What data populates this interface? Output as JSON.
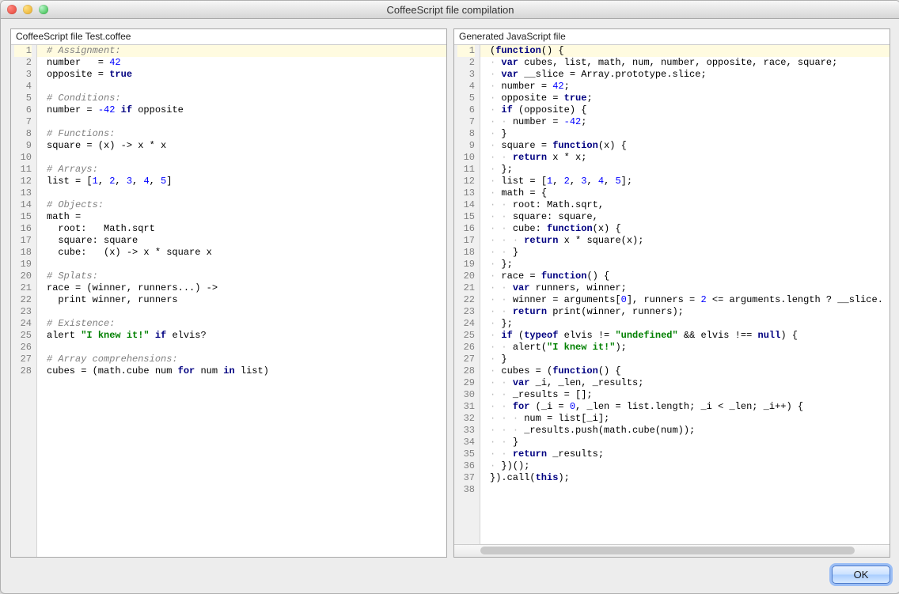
{
  "window": {
    "title": "CoffeeScript file compilation"
  },
  "footer": {
    "ok_label": "OK"
  },
  "left": {
    "header": "CoffeeScript file Test.coffee",
    "lines": [
      {
        "n": 1,
        "segs": [
          {
            "cls": "tk-comment",
            "t": "# Assignment:"
          }
        ]
      },
      {
        "n": 2,
        "segs": [
          {
            "cls": "tk-plain",
            "t": "number   = "
          },
          {
            "cls": "tk-num",
            "t": "42"
          }
        ]
      },
      {
        "n": 3,
        "segs": [
          {
            "cls": "tk-plain",
            "t": "opposite = "
          },
          {
            "cls": "tk-kw",
            "t": "true"
          }
        ]
      },
      {
        "n": 4,
        "segs": [
          {
            "cls": "tk-plain",
            "t": ""
          }
        ]
      },
      {
        "n": 5,
        "segs": [
          {
            "cls": "tk-comment",
            "t": "# Conditions:"
          }
        ]
      },
      {
        "n": 6,
        "segs": [
          {
            "cls": "tk-plain",
            "t": "number = "
          },
          {
            "cls": "tk-num",
            "t": "-42"
          },
          {
            "cls": "tk-plain",
            "t": " "
          },
          {
            "cls": "tk-kw",
            "t": "if"
          },
          {
            "cls": "tk-plain",
            "t": " opposite"
          }
        ]
      },
      {
        "n": 7,
        "segs": [
          {
            "cls": "tk-plain",
            "t": ""
          }
        ]
      },
      {
        "n": 8,
        "segs": [
          {
            "cls": "tk-comment",
            "t": "# Functions:"
          }
        ]
      },
      {
        "n": 9,
        "segs": [
          {
            "cls": "tk-plain",
            "t": "square = (x) -> x * x"
          }
        ]
      },
      {
        "n": 10,
        "segs": [
          {
            "cls": "tk-plain",
            "t": ""
          }
        ]
      },
      {
        "n": 11,
        "segs": [
          {
            "cls": "tk-comment",
            "t": "# Arrays:"
          }
        ]
      },
      {
        "n": 12,
        "segs": [
          {
            "cls": "tk-plain",
            "t": "list = ["
          },
          {
            "cls": "tk-num",
            "t": "1"
          },
          {
            "cls": "tk-plain",
            "t": ", "
          },
          {
            "cls": "tk-num",
            "t": "2"
          },
          {
            "cls": "tk-plain",
            "t": ", "
          },
          {
            "cls": "tk-num",
            "t": "3"
          },
          {
            "cls": "tk-plain",
            "t": ", "
          },
          {
            "cls": "tk-num",
            "t": "4"
          },
          {
            "cls": "tk-plain",
            "t": ", "
          },
          {
            "cls": "tk-num",
            "t": "5"
          },
          {
            "cls": "tk-plain",
            "t": "]"
          }
        ]
      },
      {
        "n": 13,
        "segs": [
          {
            "cls": "tk-plain",
            "t": ""
          }
        ]
      },
      {
        "n": 14,
        "segs": [
          {
            "cls": "tk-comment",
            "t": "# Objects:"
          }
        ]
      },
      {
        "n": 15,
        "segs": [
          {
            "cls": "tk-plain",
            "t": "math ="
          }
        ]
      },
      {
        "n": 16,
        "segs": [
          {
            "cls": "tk-plain",
            "t": "  root:   Math.sqrt"
          }
        ]
      },
      {
        "n": 17,
        "segs": [
          {
            "cls": "tk-plain",
            "t": "  square: square"
          }
        ]
      },
      {
        "n": 18,
        "segs": [
          {
            "cls": "tk-plain",
            "t": "  cube:   (x) -> x * square x"
          }
        ]
      },
      {
        "n": 19,
        "segs": [
          {
            "cls": "tk-plain",
            "t": ""
          }
        ]
      },
      {
        "n": 20,
        "segs": [
          {
            "cls": "tk-comment",
            "t": "# Splats:"
          }
        ]
      },
      {
        "n": 21,
        "segs": [
          {
            "cls": "tk-plain",
            "t": "race = (winner, runners...) ->"
          }
        ]
      },
      {
        "n": 22,
        "segs": [
          {
            "cls": "tk-plain",
            "t": "  print winner, runners"
          }
        ]
      },
      {
        "n": 23,
        "segs": [
          {
            "cls": "tk-plain",
            "t": ""
          }
        ]
      },
      {
        "n": 24,
        "segs": [
          {
            "cls": "tk-comment",
            "t": "# Existence:"
          }
        ]
      },
      {
        "n": 25,
        "segs": [
          {
            "cls": "tk-plain",
            "t": "alert "
          },
          {
            "cls": "tk-str",
            "t": "\"I knew it!\""
          },
          {
            "cls": "tk-plain",
            "t": " "
          },
          {
            "cls": "tk-kw",
            "t": "if"
          },
          {
            "cls": "tk-plain",
            "t": " elvis?"
          }
        ]
      },
      {
        "n": 26,
        "segs": [
          {
            "cls": "tk-plain",
            "t": ""
          }
        ]
      },
      {
        "n": 27,
        "segs": [
          {
            "cls": "tk-comment",
            "t": "# Array comprehensions:"
          }
        ]
      },
      {
        "n": 28,
        "segs": [
          {
            "cls": "tk-plain",
            "t": "cubes = (math.cube num "
          },
          {
            "cls": "tk-kw",
            "t": "for"
          },
          {
            "cls": "tk-plain",
            "t": " num "
          },
          {
            "cls": "tk-kw",
            "t": "in"
          },
          {
            "cls": "tk-plain",
            "t": " list)"
          }
        ]
      }
    ]
  },
  "right": {
    "header": "Generated JavaScript file",
    "lines": [
      {
        "n": 1,
        "ind": 0,
        "segs": [
          {
            "cls": "tk-plain",
            "t": "("
          },
          {
            "cls": "tk-kw",
            "t": "function"
          },
          {
            "cls": "tk-plain",
            "t": "() {"
          }
        ]
      },
      {
        "n": 2,
        "ind": 1,
        "segs": [
          {
            "cls": "tk-kw",
            "t": "var"
          },
          {
            "cls": "tk-plain",
            "t": " cubes, list, math, num, number, opposite, race, square;"
          }
        ]
      },
      {
        "n": 3,
        "ind": 1,
        "segs": [
          {
            "cls": "tk-kw",
            "t": "var"
          },
          {
            "cls": "tk-plain",
            "t": " __slice = Array.prototype.slice;"
          }
        ]
      },
      {
        "n": 4,
        "ind": 1,
        "segs": [
          {
            "cls": "tk-plain",
            "t": "number = "
          },
          {
            "cls": "tk-num",
            "t": "42"
          },
          {
            "cls": "tk-plain",
            "t": ";"
          }
        ]
      },
      {
        "n": 5,
        "ind": 1,
        "segs": [
          {
            "cls": "tk-plain",
            "t": "opposite = "
          },
          {
            "cls": "tk-kw",
            "t": "true"
          },
          {
            "cls": "tk-plain",
            "t": ";"
          }
        ]
      },
      {
        "n": 6,
        "ind": 1,
        "segs": [
          {
            "cls": "tk-kw",
            "t": "if"
          },
          {
            "cls": "tk-plain",
            "t": " (opposite) {"
          }
        ]
      },
      {
        "n": 7,
        "ind": 2,
        "segs": [
          {
            "cls": "tk-plain",
            "t": "number = "
          },
          {
            "cls": "tk-num",
            "t": "-42"
          },
          {
            "cls": "tk-plain",
            "t": ";"
          }
        ]
      },
      {
        "n": 8,
        "ind": 1,
        "segs": [
          {
            "cls": "tk-plain",
            "t": "}"
          }
        ]
      },
      {
        "n": 9,
        "ind": 1,
        "segs": [
          {
            "cls": "tk-plain",
            "t": "square = "
          },
          {
            "cls": "tk-kw",
            "t": "function"
          },
          {
            "cls": "tk-plain",
            "t": "(x) {"
          }
        ]
      },
      {
        "n": 10,
        "ind": 2,
        "segs": [
          {
            "cls": "tk-kw",
            "t": "return"
          },
          {
            "cls": "tk-plain",
            "t": " x * x;"
          }
        ]
      },
      {
        "n": 11,
        "ind": 1,
        "segs": [
          {
            "cls": "tk-plain",
            "t": "};"
          }
        ]
      },
      {
        "n": 12,
        "ind": 1,
        "segs": [
          {
            "cls": "tk-plain",
            "t": "list = ["
          },
          {
            "cls": "tk-num",
            "t": "1"
          },
          {
            "cls": "tk-plain",
            "t": ", "
          },
          {
            "cls": "tk-num",
            "t": "2"
          },
          {
            "cls": "tk-plain",
            "t": ", "
          },
          {
            "cls": "tk-num",
            "t": "3"
          },
          {
            "cls": "tk-plain",
            "t": ", "
          },
          {
            "cls": "tk-num",
            "t": "4"
          },
          {
            "cls": "tk-plain",
            "t": ", "
          },
          {
            "cls": "tk-num",
            "t": "5"
          },
          {
            "cls": "tk-plain",
            "t": "];"
          }
        ]
      },
      {
        "n": 13,
        "ind": 1,
        "segs": [
          {
            "cls": "tk-plain",
            "t": "math = {"
          }
        ]
      },
      {
        "n": 14,
        "ind": 2,
        "segs": [
          {
            "cls": "tk-plain",
            "t": "root: Math.sqrt,"
          }
        ]
      },
      {
        "n": 15,
        "ind": 2,
        "segs": [
          {
            "cls": "tk-plain",
            "t": "square: square,"
          }
        ]
      },
      {
        "n": 16,
        "ind": 2,
        "segs": [
          {
            "cls": "tk-plain",
            "t": "cube: "
          },
          {
            "cls": "tk-kw",
            "t": "function"
          },
          {
            "cls": "tk-plain",
            "t": "(x) {"
          }
        ]
      },
      {
        "n": 17,
        "ind": 3,
        "segs": [
          {
            "cls": "tk-kw",
            "t": "return"
          },
          {
            "cls": "tk-plain",
            "t": " x * square(x);"
          }
        ]
      },
      {
        "n": 18,
        "ind": 2,
        "segs": [
          {
            "cls": "tk-plain",
            "t": "}"
          }
        ]
      },
      {
        "n": 19,
        "ind": 1,
        "segs": [
          {
            "cls": "tk-plain",
            "t": "};"
          }
        ]
      },
      {
        "n": 20,
        "ind": 1,
        "segs": [
          {
            "cls": "tk-plain",
            "t": "race = "
          },
          {
            "cls": "tk-kw",
            "t": "function"
          },
          {
            "cls": "tk-plain",
            "t": "() {"
          }
        ]
      },
      {
        "n": 21,
        "ind": 2,
        "segs": [
          {
            "cls": "tk-kw",
            "t": "var"
          },
          {
            "cls": "tk-plain",
            "t": " runners, winner;"
          }
        ]
      },
      {
        "n": 22,
        "ind": 2,
        "segs": [
          {
            "cls": "tk-plain",
            "t": "winner = arguments["
          },
          {
            "cls": "tk-num",
            "t": "0"
          },
          {
            "cls": "tk-plain",
            "t": "], runners = "
          },
          {
            "cls": "tk-num",
            "t": "2"
          },
          {
            "cls": "tk-plain",
            "t": " <= arguments.length ? __slice."
          }
        ]
      },
      {
        "n": 23,
        "ind": 2,
        "segs": [
          {
            "cls": "tk-kw",
            "t": "return"
          },
          {
            "cls": "tk-plain",
            "t": " print(winner, runners);"
          }
        ]
      },
      {
        "n": 24,
        "ind": 1,
        "segs": [
          {
            "cls": "tk-plain",
            "t": "};"
          }
        ]
      },
      {
        "n": 25,
        "ind": 1,
        "segs": [
          {
            "cls": "tk-kw",
            "t": "if"
          },
          {
            "cls": "tk-plain",
            "t": " ("
          },
          {
            "cls": "tk-kw",
            "t": "typeof"
          },
          {
            "cls": "tk-plain",
            "t": " elvis != "
          },
          {
            "cls": "tk-str",
            "t": "\"undefined\""
          },
          {
            "cls": "tk-plain",
            "t": " && elvis !== "
          },
          {
            "cls": "tk-kw",
            "t": "null"
          },
          {
            "cls": "tk-plain",
            "t": ") {"
          }
        ]
      },
      {
        "n": 26,
        "ind": 2,
        "segs": [
          {
            "cls": "tk-plain",
            "t": "alert("
          },
          {
            "cls": "tk-str",
            "t": "\"I knew it!\""
          },
          {
            "cls": "tk-plain",
            "t": ");"
          }
        ]
      },
      {
        "n": 27,
        "ind": 1,
        "segs": [
          {
            "cls": "tk-plain",
            "t": "}"
          }
        ]
      },
      {
        "n": 28,
        "ind": 1,
        "segs": [
          {
            "cls": "tk-plain",
            "t": "cubes = ("
          },
          {
            "cls": "tk-kw",
            "t": "function"
          },
          {
            "cls": "tk-plain",
            "t": "() {"
          }
        ]
      },
      {
        "n": 29,
        "ind": 2,
        "segs": [
          {
            "cls": "tk-kw",
            "t": "var"
          },
          {
            "cls": "tk-plain",
            "t": " _i, _len, _results;"
          }
        ]
      },
      {
        "n": 30,
        "ind": 2,
        "segs": [
          {
            "cls": "tk-plain",
            "t": "_results = [];"
          }
        ]
      },
      {
        "n": 31,
        "ind": 2,
        "segs": [
          {
            "cls": "tk-kw",
            "t": "for"
          },
          {
            "cls": "tk-plain",
            "t": " (_i = "
          },
          {
            "cls": "tk-num",
            "t": "0"
          },
          {
            "cls": "tk-plain",
            "t": ", _len = list.length; _i < _len; _i++) {"
          }
        ]
      },
      {
        "n": 32,
        "ind": 3,
        "segs": [
          {
            "cls": "tk-plain",
            "t": "num = list[_i];"
          }
        ]
      },
      {
        "n": 33,
        "ind": 3,
        "segs": [
          {
            "cls": "tk-plain",
            "t": "_results.push(math.cube(num));"
          }
        ]
      },
      {
        "n": 34,
        "ind": 2,
        "segs": [
          {
            "cls": "tk-plain",
            "t": "}"
          }
        ]
      },
      {
        "n": 35,
        "ind": 2,
        "segs": [
          {
            "cls": "tk-kw",
            "t": "return"
          },
          {
            "cls": "tk-plain",
            "t": " _results;"
          }
        ]
      },
      {
        "n": 36,
        "ind": 1,
        "segs": [
          {
            "cls": "tk-plain",
            "t": "})();"
          }
        ]
      },
      {
        "n": 37,
        "ind": 0,
        "segs": [
          {
            "cls": "tk-plain",
            "t": "}).call("
          },
          {
            "cls": "tk-kw",
            "t": "this"
          },
          {
            "cls": "tk-plain",
            "t": ");"
          }
        ]
      },
      {
        "n": 38,
        "ind": 0,
        "segs": [
          {
            "cls": "tk-plain",
            "t": ""
          }
        ]
      }
    ]
  }
}
